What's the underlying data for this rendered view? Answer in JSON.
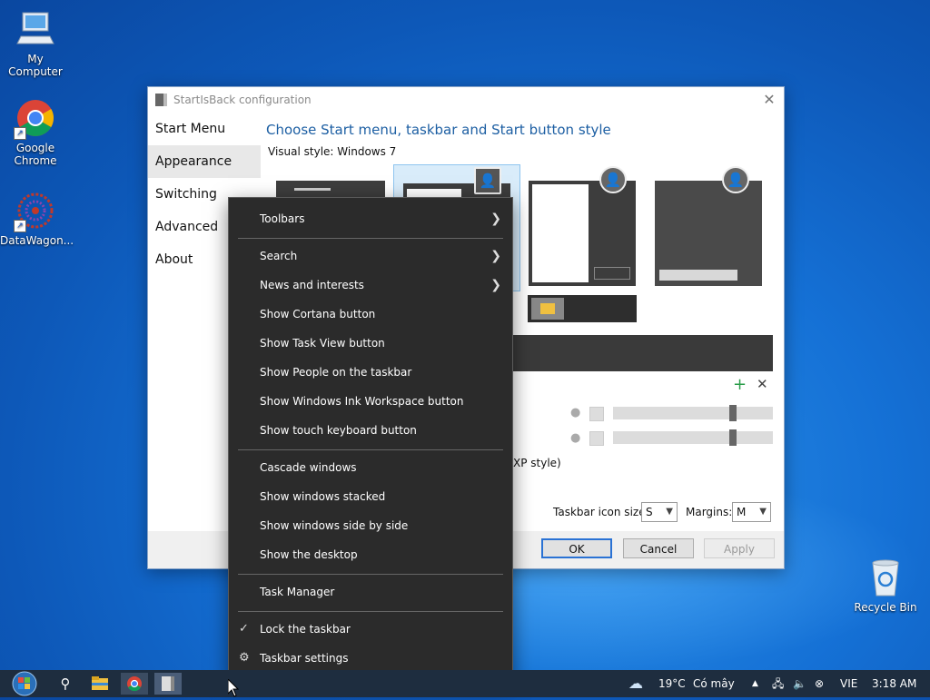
{
  "desktop": {
    "icons": [
      {
        "label": "My Computer",
        "icon": "computer-icon"
      },
      {
        "label": "Google Chrome",
        "icon": "chrome-icon"
      },
      {
        "label": "DataWagon...",
        "icon": "datawagon-icon"
      },
      {
        "label": "Recycle Bin",
        "icon": "recycle-bin-icon"
      }
    ]
  },
  "config_window": {
    "title": "StartIsBack configuration",
    "sidebar": [
      "Start Menu",
      "Appearance",
      "Switching",
      "Advanced",
      "About"
    ],
    "active_sidebar": "Appearance",
    "heading": "Choose Start menu, taskbar and Start button style",
    "visual_style_label": "Visual style:",
    "visual_style_value": "Windows 7",
    "partial_option_text": "XP style)",
    "taskbar_icon_size_label": "Taskbar icon size:",
    "taskbar_icon_size_value": "S",
    "margins_label": "Margins:",
    "margins_value": "M",
    "buttons": {
      "ok": "OK",
      "cancel": "Cancel",
      "apply": "Apply"
    }
  },
  "context_menu": {
    "items": [
      {
        "label": "Toolbars",
        "submenu": true
      },
      {
        "label": "Search",
        "submenu": true
      },
      {
        "label": "News and interests",
        "submenu": true
      },
      {
        "label": "Show Cortana button"
      },
      {
        "label": "Show Task View button"
      },
      {
        "label": "Show People on the taskbar"
      },
      {
        "label": "Show Windows Ink Workspace button"
      },
      {
        "label": "Show touch keyboard button"
      },
      {
        "label": "Cascade windows"
      },
      {
        "label": "Show windows stacked"
      },
      {
        "label": "Show windows side by side"
      },
      {
        "label": "Show the desktop"
      },
      {
        "label": "Task Manager"
      },
      {
        "label": "Lock the taskbar",
        "checked": true
      },
      {
        "label": "Taskbar settings",
        "icon": "gear-icon"
      }
    ]
  },
  "taskbar": {
    "weather_temp": "19°C",
    "weather_text": "Có mây",
    "language": "VIE",
    "clock": "3:18 AM"
  },
  "colors": {
    "desktop_blue": "#1571d6",
    "menu_bg": "#2b2b2b",
    "taskbar_bg": "#1e2d3f",
    "accent": "#1d5fa3"
  }
}
